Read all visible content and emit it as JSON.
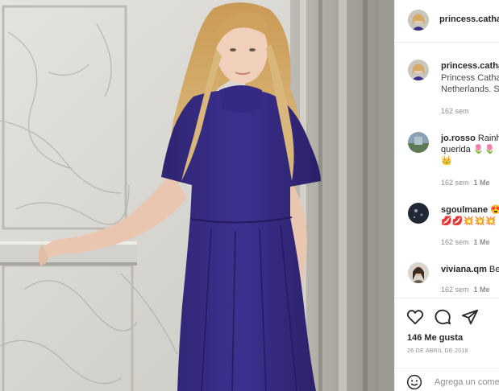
{
  "post": {
    "author": "princess.catha",
    "caption_author": "princess.catha",
    "caption_line1": "Princess Catha",
    "caption_line2": "Netherlands. S",
    "caption_time": "162 sem"
  },
  "comments": [
    {
      "user": "jo.rosso",
      "text1": "Rainh",
      "text2": "querida",
      "emoji2": "🌷🌷",
      "text3": "👑",
      "time": "162 sem",
      "likes": "1 Me"
    },
    {
      "user": "sgoulmane",
      "text1": "😍",
      "text2": "💋💋💥💥💥",
      "time": "162 sem",
      "likes": "1 Me"
    },
    {
      "user": "viviana.qm",
      "text1": "Be",
      "time": "162 sem",
      "likes": "1 Me"
    }
  ],
  "actions": {
    "likes_count": "146 Me gusta",
    "date": "26 DE ABRIL DE 2018",
    "add_comment_placeholder": "Agrega un come"
  },
  "colors": {
    "dress": "#3a2e86",
    "marble": "#d9d7d2",
    "hair": "#d8b274",
    "muted_text": "#8e8e8e"
  },
  "icons": [
    "heart-icon",
    "comment-icon",
    "share-icon",
    "emoji-icon"
  ]
}
